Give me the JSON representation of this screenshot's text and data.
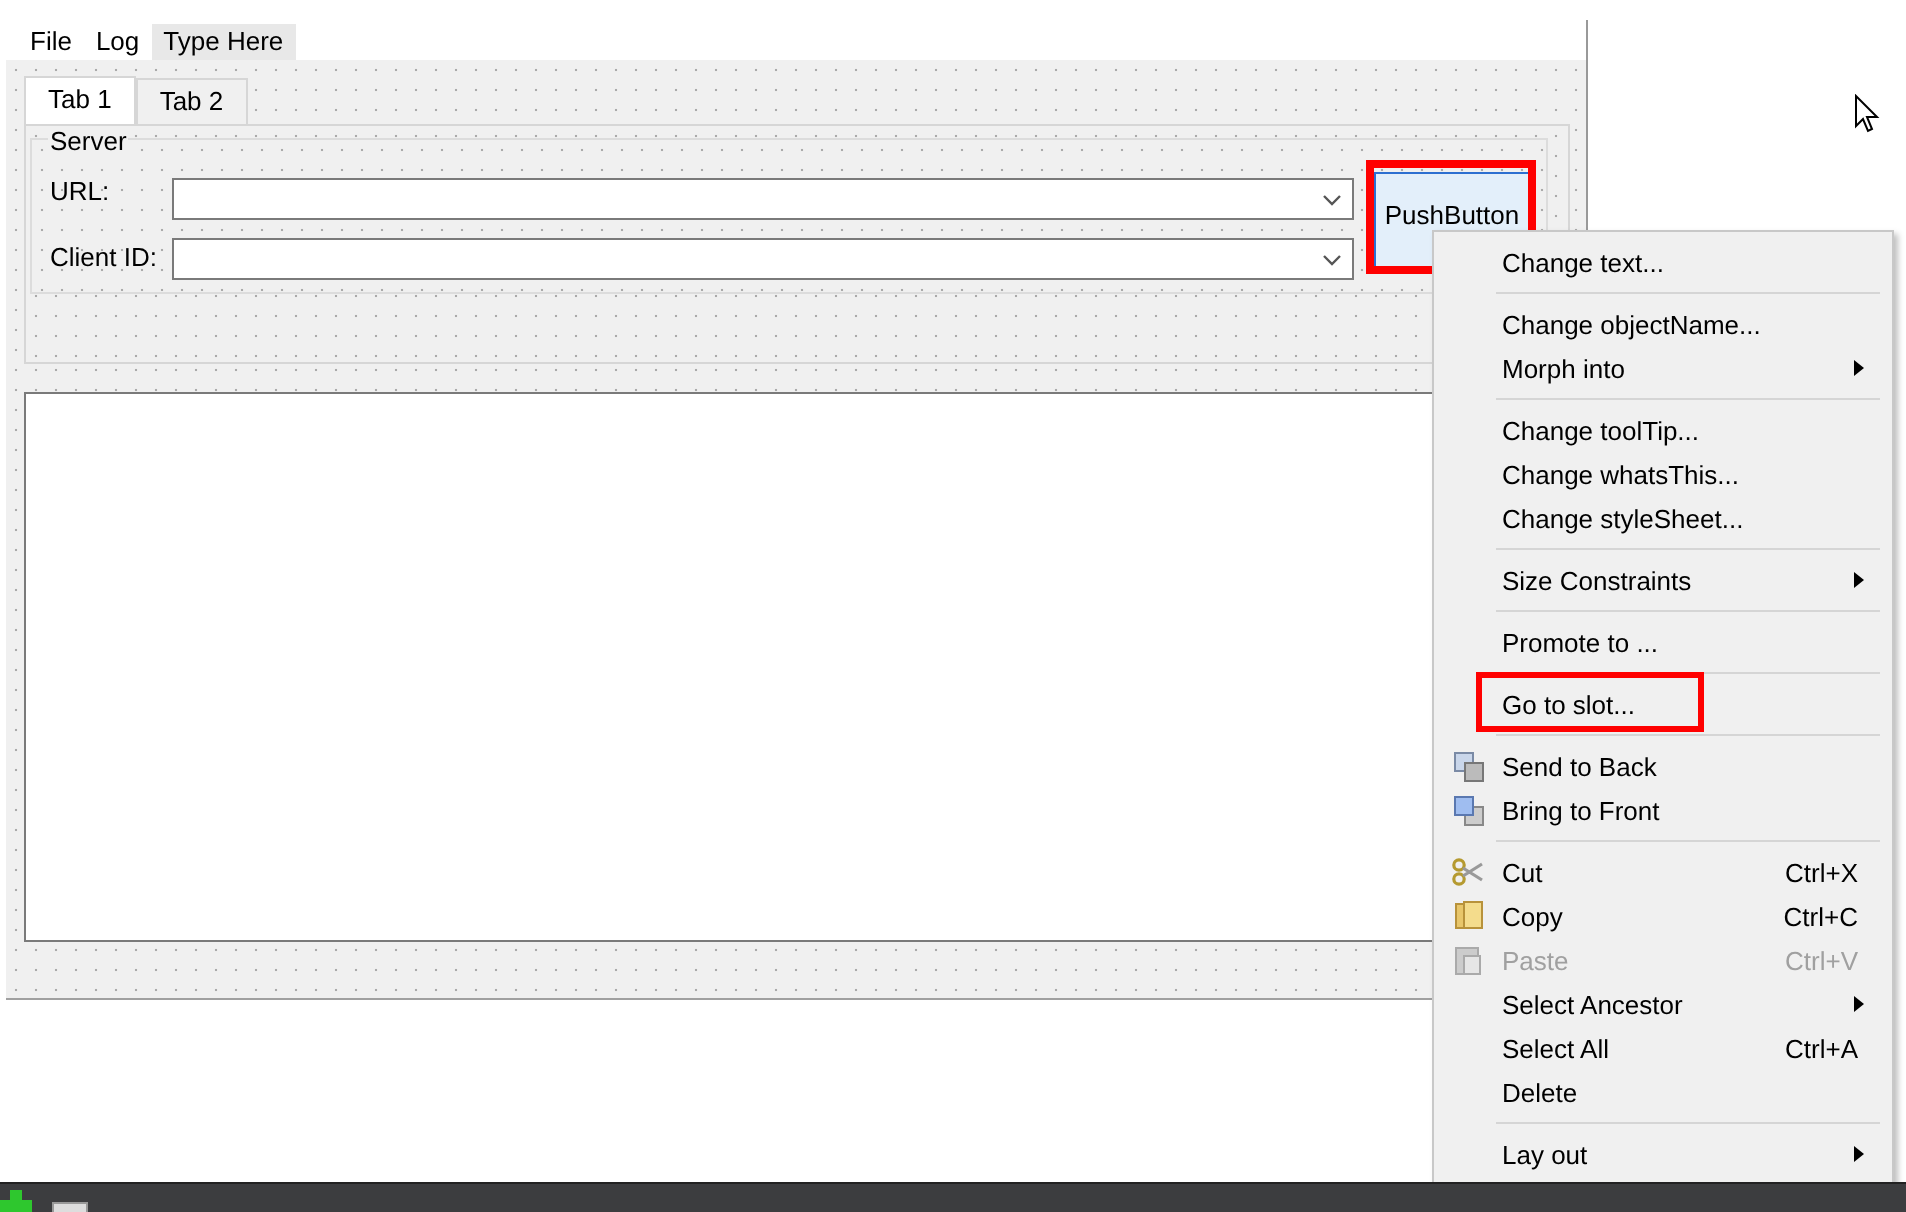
{
  "menu_bar": [
    {
      "label": "File",
      "placeholder": false
    },
    {
      "label": "Log",
      "placeholder": false
    },
    {
      "label": "Type Here",
      "placeholder": true
    }
  ],
  "tabs": [
    {
      "label": "Tab 1",
      "selected": true
    },
    {
      "label": "Tab 2",
      "selected": false
    }
  ],
  "group_box": {
    "title": "Server",
    "fields": [
      {
        "label": "URL:"
      },
      {
        "label": "Client ID:"
      }
    ]
  },
  "push_button": {
    "label": "PushButton",
    "selected": true,
    "marked": true
  },
  "context_menu": [
    {
      "kind": "item",
      "label": "Change text...",
      "disabled": false,
      "submenu": false,
      "marked": false
    },
    {
      "kind": "separator"
    },
    {
      "kind": "item",
      "label": "Change objectName...",
      "disabled": false,
      "submenu": false,
      "marked": false
    },
    {
      "kind": "item",
      "label": "Morph into",
      "disabled": false,
      "submenu": true,
      "marked": false
    },
    {
      "kind": "separator"
    },
    {
      "kind": "item",
      "label": "Change toolTip...",
      "disabled": false,
      "submenu": false,
      "marked": false
    },
    {
      "kind": "item",
      "label": "Change whatsThis...",
      "disabled": false,
      "submenu": false,
      "marked": false
    },
    {
      "kind": "item",
      "label": "Change styleSheet...",
      "disabled": false,
      "submenu": false,
      "marked": false
    },
    {
      "kind": "separator"
    },
    {
      "kind": "item",
      "label": "Size Constraints",
      "disabled": false,
      "submenu": true,
      "marked": false
    },
    {
      "kind": "separator"
    },
    {
      "kind": "item",
      "label": "Promote to ...",
      "disabled": false,
      "submenu": false,
      "marked": false
    },
    {
      "kind": "separator"
    },
    {
      "kind": "item",
      "label": "Go to slot...",
      "disabled": false,
      "submenu": false,
      "marked": true
    },
    {
      "kind": "separator"
    },
    {
      "kind": "item",
      "label": "Send to Back",
      "disabled": false,
      "submenu": false,
      "marked": false
    },
    {
      "kind": "item",
      "label": "Bring to Front",
      "disabled": false,
      "submenu": false,
      "marked": false
    },
    {
      "kind": "separator"
    },
    {
      "kind": "item",
      "label": "Cut",
      "shortcut": "Ctrl+X",
      "disabled": false,
      "submenu": false,
      "marked": false
    },
    {
      "kind": "item",
      "label": "Copy",
      "shortcut": "Ctrl+C",
      "disabled": false,
      "submenu": false,
      "marked": false
    },
    {
      "kind": "item",
      "label": "Paste",
      "shortcut": "Ctrl+V",
      "disabled": true,
      "submenu": false,
      "marked": false
    },
    {
      "kind": "item",
      "label": "Select Ancestor",
      "disabled": false,
      "submenu": true,
      "marked": false
    },
    {
      "kind": "item",
      "label": "Select All",
      "shortcut": "Ctrl+A",
      "disabled": false,
      "submenu": false,
      "marked": false
    },
    {
      "kind": "item",
      "label": "Delete",
      "disabled": false,
      "submenu": false,
      "marked": false
    },
    {
      "kind": "separator"
    },
    {
      "kind": "item",
      "label": "Lay out",
      "disabled": false,
      "submenu": true,
      "marked": false
    }
  ]
}
